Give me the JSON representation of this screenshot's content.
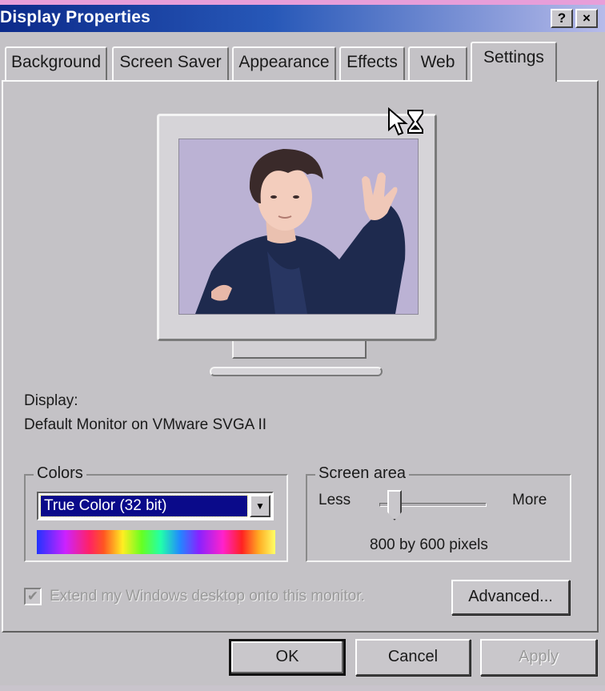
{
  "window": {
    "title": "Display Properties",
    "help_button": "?",
    "close_button": "×"
  },
  "tabs": [
    {
      "label": "Background"
    },
    {
      "label": "Screen Saver"
    },
    {
      "label": "Appearance"
    },
    {
      "label": "Effects"
    },
    {
      "label": "Web"
    },
    {
      "label": "Settings",
      "active": true
    }
  ],
  "display": {
    "label": "Display:",
    "monitor_name": "Default Monitor on VMware SVGA II"
  },
  "colors": {
    "legend": "Colors",
    "selected": "True Color (32 bit)"
  },
  "screen_area": {
    "legend": "Screen area",
    "less_label": "Less",
    "more_label": "More",
    "resolution": "800 by 600 pixels"
  },
  "extend_desktop": {
    "label": "Extend my Windows desktop onto this monitor.",
    "checked": true,
    "enabled": false
  },
  "buttons": {
    "advanced": "Advanced...",
    "ok": "OK",
    "cancel": "Cancel",
    "apply": "Apply"
  },
  "icons": {
    "cursor": "busy-pointer-icon",
    "dropdown": "chevron-down-icon",
    "check": "check-icon"
  }
}
